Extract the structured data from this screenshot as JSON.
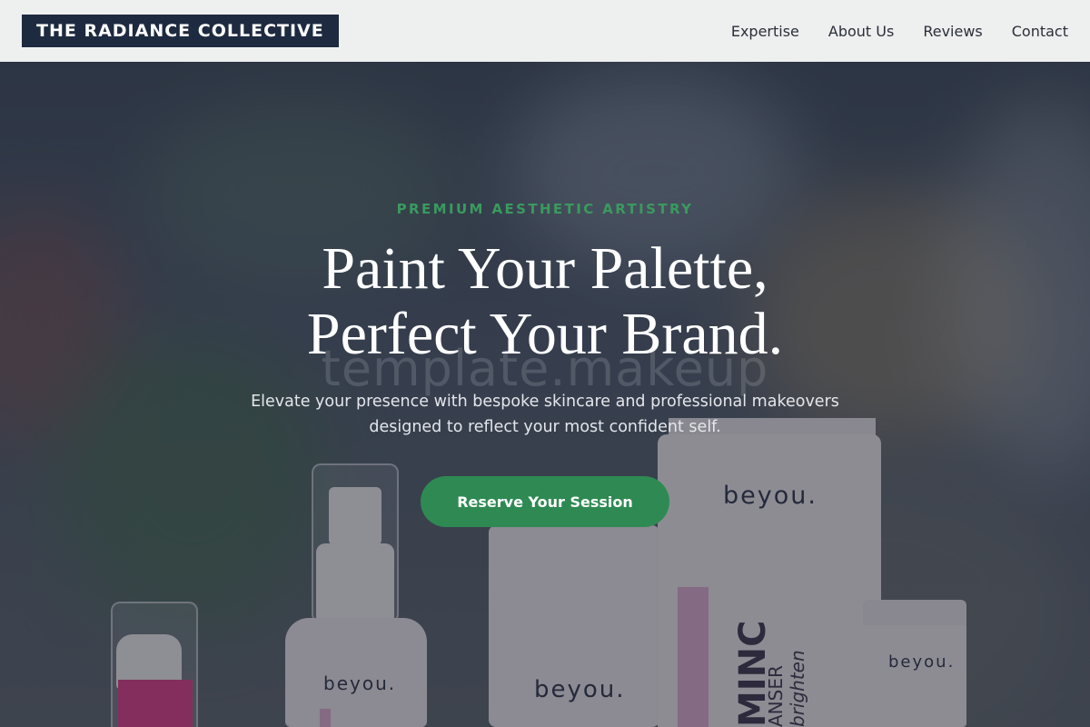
{
  "header": {
    "logo": "THE RADIANCE COLLECTIVE",
    "nav": [
      {
        "label": "Expertise"
      },
      {
        "label": "About Us"
      },
      {
        "label": "Reviews"
      },
      {
        "label": "Contact"
      }
    ]
  },
  "hero": {
    "eyebrow": "PREMIUM AESTHETIC ARTISTRY",
    "headline_line1": "Paint Your Palette,",
    "headline_line2": "Perfect Your Brand.",
    "watermark": "template.makeup",
    "subtext": "Elevate your presence with bespoke skincare and professional makeovers designed to reflect your most confident self.",
    "cta_label": "Reserve Your Session",
    "product_brand": "beyou.",
    "product_tube_text": "MINC",
    "product_tube_subtext": "ANSER",
    "product_tube_script": "brighten"
  },
  "colors": {
    "accent_green": "#2e8a52",
    "eyebrow_green": "#3a9a5e",
    "logo_bg": "#1d2a40",
    "header_bg": "#eeefef"
  }
}
